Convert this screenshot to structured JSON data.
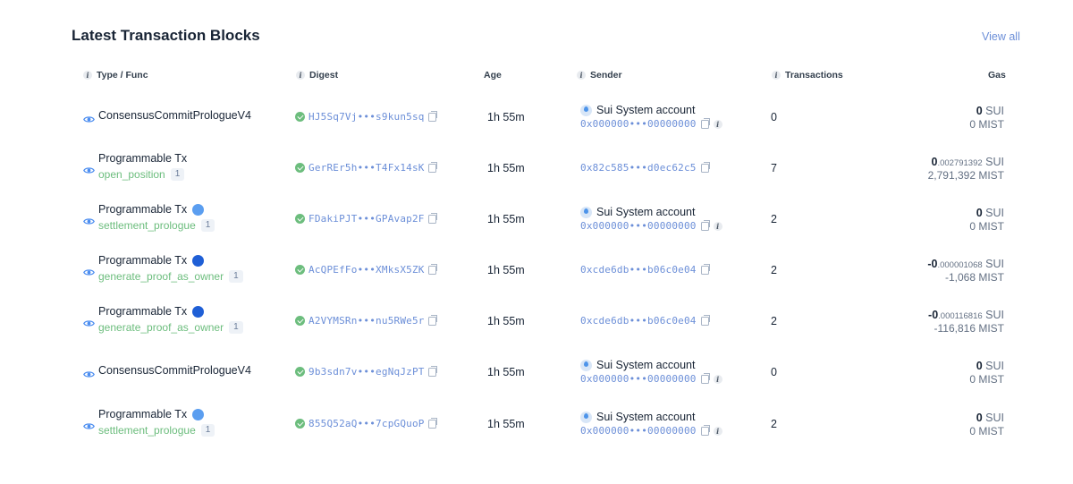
{
  "title": "Latest Transaction Blocks",
  "view_all": "View all",
  "headers": {
    "type_func": "Type / Func",
    "digest": "Digest",
    "age": "Age",
    "sender": "Sender",
    "transactions": "Transactions",
    "gas": "Gas"
  },
  "rows": [
    {
      "type": "ConsensusCommitPrologueV4",
      "func": "",
      "func_count": "",
      "pkg_icon": "",
      "digest": "HJ5Sq7Vj•••s9kun5sq",
      "age": "1h 55m",
      "sender_name": "Sui System account",
      "sender_addr": "0x000000•••00000000",
      "transactions": "0",
      "gas_int": "0",
      "gas_frac": "",
      "gas_unit": "SUI",
      "mist": "0 MIST"
    },
    {
      "type": "Programmable Tx",
      "func": "open_position",
      "func_count": "1",
      "pkg_icon": "",
      "digest": "GerREr5h•••T4Fx14sK",
      "age": "1h 55m",
      "sender_name": "",
      "sender_addr": "0x82c585•••d0ec62c5",
      "transactions": "7",
      "gas_int": "0",
      "gas_frac": ".002791392",
      "gas_unit": "SUI",
      "mist": "2,791,392 MIST"
    },
    {
      "type": "Programmable Tx",
      "func": "settlement_prologue",
      "func_count": "1",
      "pkg_icon": "sui-logo-icon",
      "digest": "FDakiPJT•••GPAvap2F",
      "age": "1h 55m",
      "sender_name": "Sui System account",
      "sender_addr": "0x000000•••00000000",
      "transactions": "2",
      "gas_int": "0",
      "gas_frac": "",
      "gas_unit": "SUI",
      "mist": "0 MIST"
    },
    {
      "type": "Programmable Tx",
      "func": "generate_proof_as_owner",
      "func_count": "1",
      "pkg_icon": "package-logo-icon",
      "digest": "AcQPEfFo•••XMksX5ZK",
      "age": "1h 55m",
      "sender_name": "",
      "sender_addr": "0xcde6db•••b06c0e04",
      "transactions": "2",
      "gas_int": "-0",
      "gas_frac": ".000001068",
      "gas_unit": "SUI",
      "mist": "-1,068 MIST"
    },
    {
      "type": "Programmable Tx",
      "func": "generate_proof_as_owner",
      "func_count": "1",
      "pkg_icon": "package-logo-icon",
      "digest": "A2VYMSRn•••nu5RWe5r",
      "age": "1h 55m",
      "sender_name": "",
      "sender_addr": "0xcde6db•••b06c0e04",
      "transactions": "2",
      "gas_int": "-0",
      "gas_frac": ".000116816",
      "gas_unit": "SUI",
      "mist": "-116,816 MIST"
    },
    {
      "type": "ConsensusCommitPrologueV4",
      "func": "",
      "func_count": "",
      "pkg_icon": "",
      "digest": "9b3sdn7v•••egNqJzPT",
      "age": "1h 55m",
      "sender_name": "Sui System account",
      "sender_addr": "0x000000•••00000000",
      "transactions": "0",
      "gas_int": "0",
      "gas_frac": "",
      "gas_unit": "SUI",
      "mist": "0 MIST"
    },
    {
      "type": "Programmable Tx",
      "func": "settlement_prologue",
      "func_count": "1",
      "pkg_icon": "sui-logo-icon",
      "digest": "855Q52aQ•••7cpGQuoP",
      "age": "1h 55m",
      "sender_name": "Sui System account",
      "sender_addr": "0x000000•••00000000",
      "transactions": "2",
      "gas_int": "0",
      "gas_frac": "",
      "gas_unit": "SUI",
      "mist": "0 MIST"
    }
  ],
  "colors": {
    "link": "#6c8fd8",
    "func": "#6cbd7d",
    "text": "#182435",
    "muted": "#637083"
  }
}
